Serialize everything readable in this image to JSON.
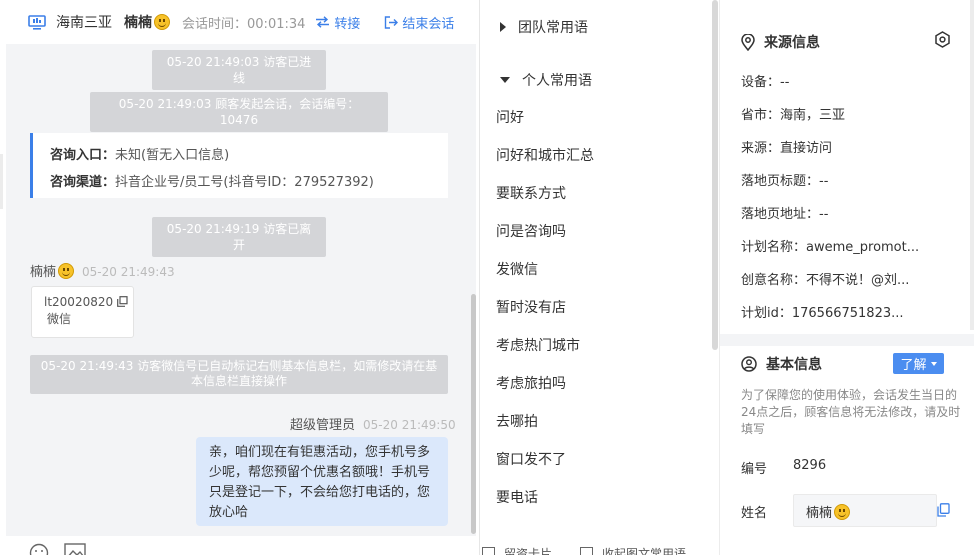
{
  "header": {
    "city": "海南三亚",
    "visitor_name": "楠楠",
    "session_time_label": "会话时间：",
    "session_time": "00:01:34",
    "transfer_label": "转接",
    "end_label": "结束会话"
  },
  "messages": {
    "sys_visitor_in": "05-20 21:49:03 访客已进线",
    "sys_session_start": "05-20 21:49:03 顾客发起会话，会话编号：10476",
    "entry_label": "咨询入口：",
    "entry_value": "未知(暂无入口信息)",
    "channel_label": "咨询渠道：",
    "channel_value": "抖音企业号/员工号(抖音号ID：279527392)",
    "sys_visitor_left": "05-20 21:49:19 访客已离开",
    "visitor_sender": "楠楠",
    "visitor_time": "05-20 21:49:43",
    "wechat_id": "lt20020820",
    "wechat_label": "微信",
    "sys_wechat_marked": "05-20 21:49:43 访客微信号已自动标记右侧基本信息栏，如需修改请在基本信息栏直接操作",
    "agent_sender": "超级管理员",
    "agent_time": "05-20 21:49:50",
    "agent_message": "亲，咱们现在有钜惠活动，您手机号多少呢，帮您预留个优惠名额哦！手机号只是登记一下，不会给您打电话的，您放心哈"
  },
  "footer": {
    "emoji_icon": "smile-icon",
    "image_icon": "image-icon"
  },
  "phrases": {
    "team_group": "团队常用语",
    "personal_group": "个人常用语",
    "items": [
      "问好",
      "问好和城市汇总",
      "要联系方式",
      "问是咨询吗",
      "发微信",
      "暂时没有店",
      "考虑热门城市",
      "考虑旅拍吗",
      "去哪拍",
      "窗口发不了",
      "要电话"
    ],
    "footer_left": "留资卡片",
    "footer_right": "收起图文常用语"
  },
  "source_info": {
    "title": "来源信息",
    "device": "设备：--",
    "province_city": "省市：海南，三亚",
    "source": "来源：直接访问",
    "landing_title": "落地页标题：--",
    "landing_url": "落地页地址：--",
    "plan_name": "计划名称：aweme_promot...",
    "creative_name": "创意名称：不得不说！@刘...",
    "plan_id": "计划id：176566751823..."
  },
  "basic_info": {
    "title": "基本信息",
    "learn_more": "了解",
    "notice": "为了保障您的使用体验，会话发生当日的24点之后，顾客信息将无法修改，请及时填写",
    "number_label": "编号",
    "number_value": "8296",
    "name_label": "姓名",
    "name_value": "楠楠"
  },
  "colors": {
    "accent": "#3b7fe8",
    "system_message_bg": "#d4d5d8",
    "chat_bg": "#f3f4f6",
    "agent_bubble": "#dbe8fb"
  }
}
